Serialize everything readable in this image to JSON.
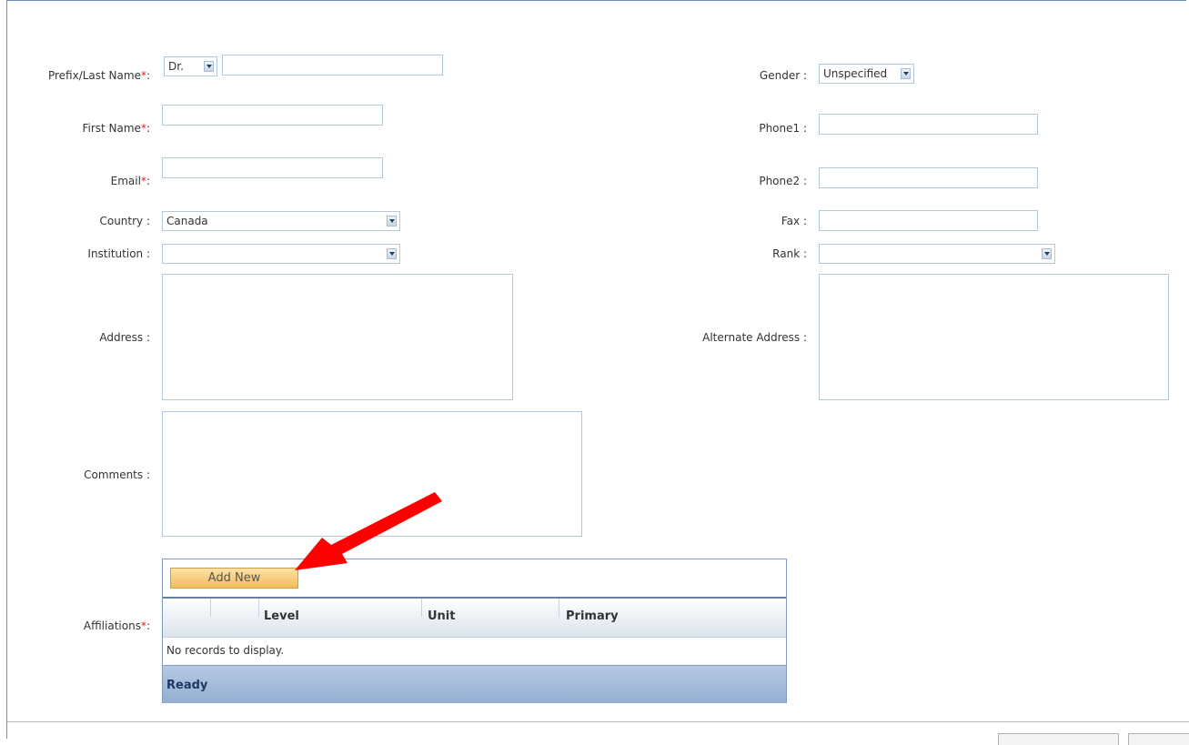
{
  "form": {
    "prefix_last_label": "Prefix/Last Name",
    "first_name_label": "First Name",
    "email_label": "Email",
    "required_mark": "*",
    "required_suffix": ":",
    "country_label": "Country :",
    "institution_label": "Institution :",
    "address_label": "Address :",
    "comments_label": "Comments :",
    "affiliations_label": "Affiliations",
    "gender_label": "Gender :",
    "phone1_label": "Phone1 :",
    "phone2_label": "Phone2 :",
    "fax_label": "Fax :",
    "rank_label": "Rank :",
    "alt_address_label": "Alternate Address :",
    "prefix_value": "Dr.",
    "last_name_value": "",
    "first_name_value": "",
    "email_value": "",
    "country_value": "Canada",
    "institution_value": "",
    "gender_value": "Unspecified",
    "phone1_value": "",
    "phone2_value": "",
    "fax_value": "",
    "rank_value": "",
    "address_value": "",
    "alt_address_value": "",
    "comments_value": ""
  },
  "affiliations_grid": {
    "add_button_label": "Add New",
    "columns": [
      "Level",
      "Unit",
      "Primary"
    ],
    "empty_text": "No records to display.",
    "status_text": "Ready"
  },
  "annotation": {
    "arrow_color": "#ff0000"
  }
}
